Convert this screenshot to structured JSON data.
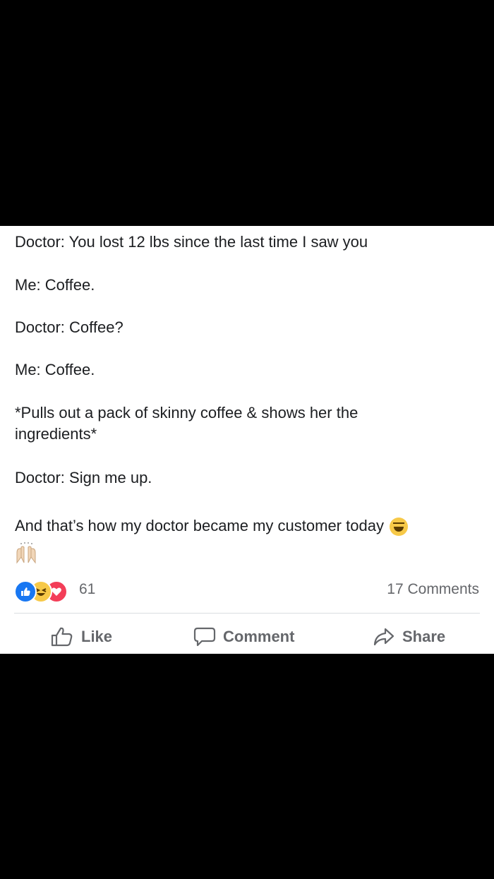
{
  "post": {
    "lines": [
      "Doctor: You lost 12 lbs since the last time I saw you",
      "Me: Coffee.",
      "Doctor: Coffee?",
      "Me: Coffee.",
      "*Pulls out a pack of skinny coffee & shows her the ingredients*",
      "Doctor: Sign me up.",
      "And that’s how my doctor became my customer today"
    ],
    "emoji_end": "laughing-tears-icon",
    "emoji_line2": "raised-hands-icon"
  },
  "footer": {
    "reaction_icons": [
      "like-icon",
      "haha-icon",
      "love-icon"
    ],
    "reaction_count": "61",
    "comments_label": "17 Comments"
  },
  "actions": {
    "like": "Like",
    "comment": "Comment",
    "share": "Share"
  },
  "colors": {
    "background": "#000000",
    "card": "#ffffff",
    "like_blue": "#1877f2",
    "love_red": "#f33e58",
    "haha_yellow": "#f7c948",
    "muted_text": "#65676b"
  }
}
